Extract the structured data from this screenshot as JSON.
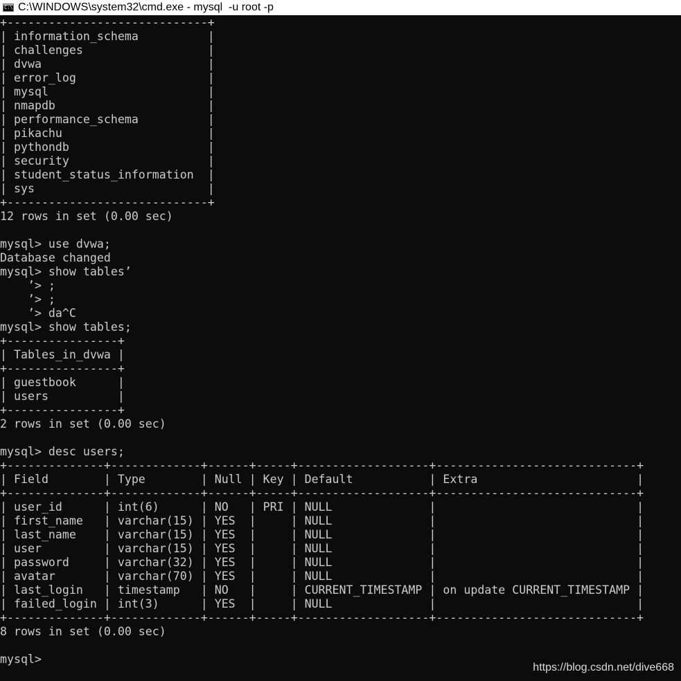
{
  "window": {
    "title": "C:\\WINDOWS\\system32\\cmd.exe - mysql  -u root -p",
    "icon": "cmd-icon",
    "icon_text": "C:\\"
  },
  "colors": {
    "background": "#0c0c0c",
    "foreground": "#cccccc",
    "titlebar": "#ffffff"
  },
  "console": {
    "lines": [
      "+-----------------------------+",
      "| information_schema          |",
      "| challenges                  |",
      "| dvwa                        |",
      "| error_log                   |",
      "| mysql                       |",
      "| nmapdb                      |",
      "| performance_schema          |",
      "| pikachu                     |",
      "| pythondb                    |",
      "| security                    |",
      "| student_status_information  |",
      "| sys                         |",
      "+-----------------------------+",
      "12 rows in set (0.00 sec)",
      "",
      "mysql> use dvwa;",
      "Database changed",
      "mysql> show tables’",
      "    ’> ;",
      "    ’> ;",
      "    ’> da^C",
      "mysql> show tables;",
      "+----------------+",
      "| Tables_in_dvwa |",
      "+----------------+",
      "| guestbook      |",
      "| users          |",
      "+----------------+",
      "2 rows in set (0.00 sec)",
      "",
      "mysql> desc users;",
      "+--------------+-------------+------+-----+-------------------+-----------------------------+",
      "| Field        | Type        | Null | Key | Default           | Extra                       |",
      "+--------------+-------------+------+-----+-------------------+-----------------------------+",
      "| user_id      | int(6)      | NO   | PRI | NULL              |                             |",
      "| first_name   | varchar(15) | YES  |     | NULL              |                             |",
      "| last_name    | varchar(15) | YES  |     | NULL              |                             |",
      "| user         | varchar(15) | YES  |     | NULL              |                             |",
      "| password     | varchar(32) | YES  |     | NULL              |                             |",
      "| avatar       | varchar(70) | YES  |     | NULL              |                             |",
      "| last_login   | timestamp   | NO   |     | CURRENT_TIMESTAMP | on update CURRENT_TIMESTAMP |",
      "| failed_login | int(3)      | YES  |     | NULL              |                             |",
      "+--------------+-------------+------+-----+-------------------+-----------------------------+",
      "8 rows in set (0.00 sec)",
      "",
      "mysql>"
    ]
  },
  "watermark": "https://blog.csdn.net/dive668"
}
